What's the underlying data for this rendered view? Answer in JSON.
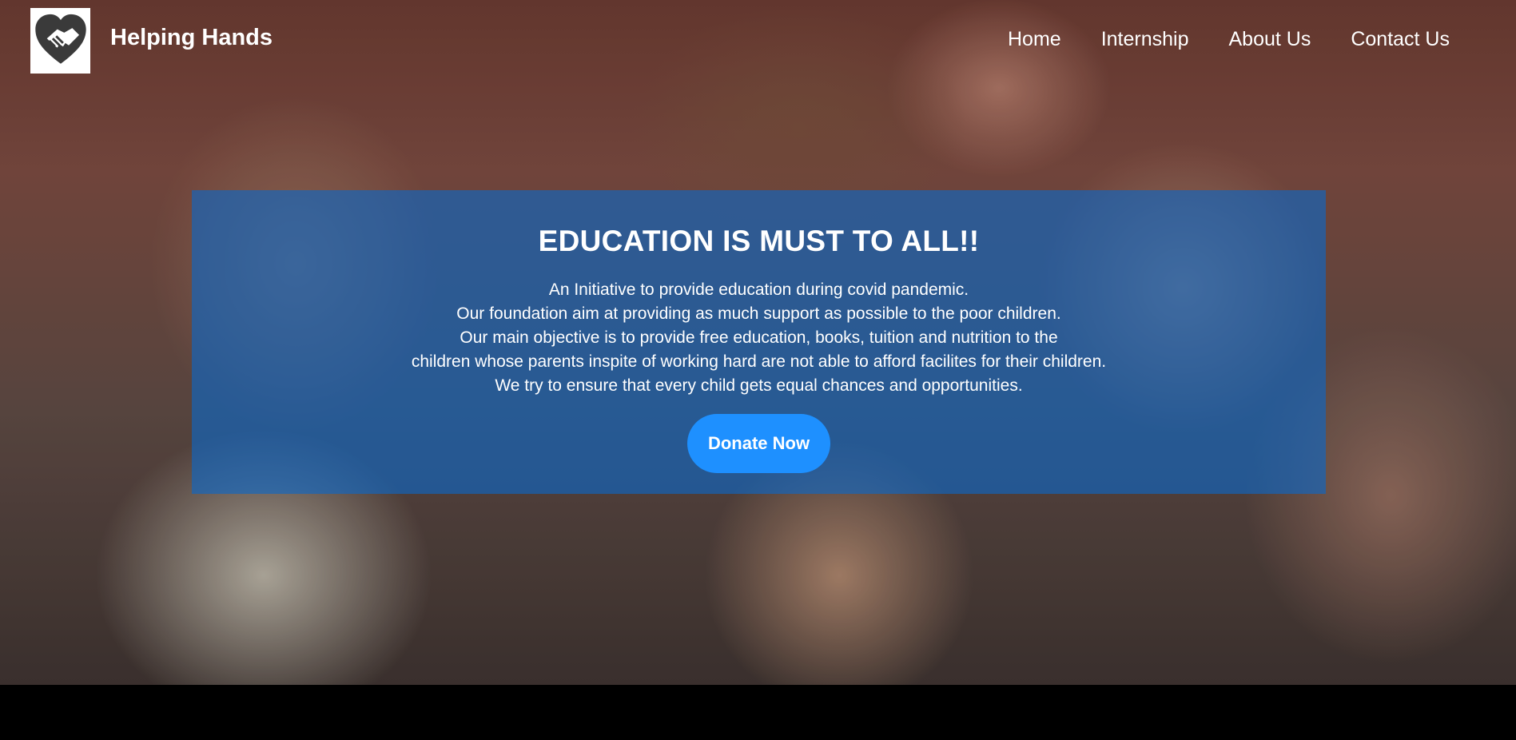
{
  "header": {
    "brand": "Helping Hands",
    "logo_icon": "handshake-heart-icon",
    "nav": [
      "Home",
      "Internship",
      "About Us",
      "Contact Us"
    ]
  },
  "banner": {
    "title": "EDUCATION IS MUST TO ALL!!",
    "lines": [
      "An Initiative to provide education during covid pandemic.",
      "Our foundation aim at providing as much support as possible to the poor children.",
      "Our main objective is to provide free education, books, tuition and nutrition to the",
      "children whose parents inspite of working hard are not able to afford facilites for their children.",
      "We try to ensure that every child gets equal chances and opportunities."
    ],
    "button_label": "Donate Now"
  },
  "colors": {
    "banner_overlay": "#0c68c8",
    "button": "#1e90ff",
    "text": "#ffffff"
  }
}
